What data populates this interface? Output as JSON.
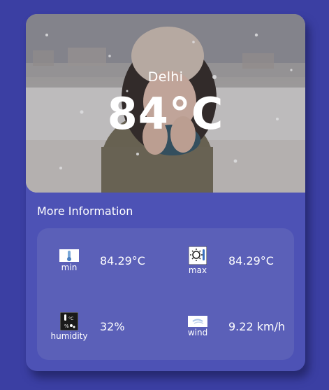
{
  "weather": {
    "city": "Delhi",
    "temperature": "84°C"
  },
  "more_info": {
    "title": "More Information",
    "stats": [
      {
        "label": "min",
        "value": "84.29°C",
        "icon": "thermometer-low-icon"
      },
      {
        "label": "max",
        "value": "84.29°C",
        "icon": "sun-thermometer-icon"
      },
      {
        "label": "humidity",
        "value": "32%",
        "icon": "humidity-icon"
      },
      {
        "label": "wind",
        "value": "9.22 km/h",
        "icon": "wind-icon"
      }
    ]
  },
  "colors": {
    "background": "#3b3fa3",
    "card": "#4d52b5",
    "panel": "#5b60b8"
  }
}
